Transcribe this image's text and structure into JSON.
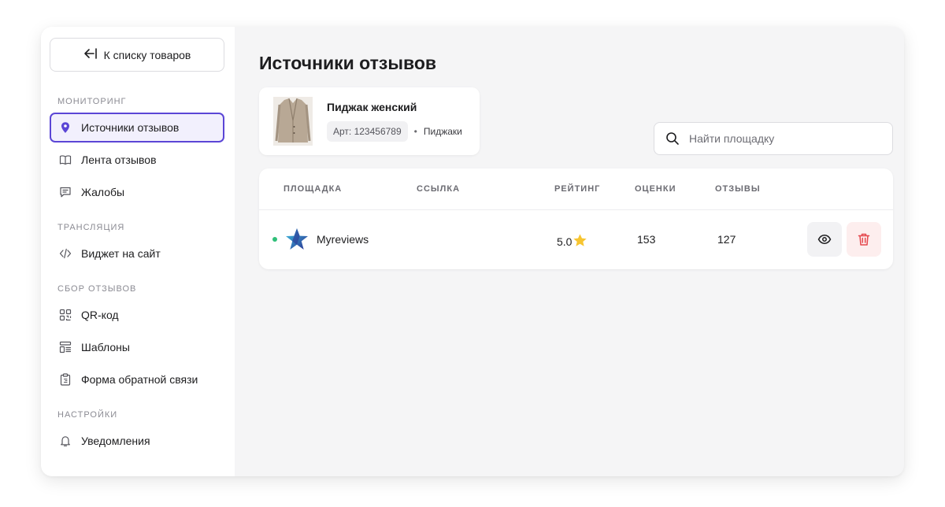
{
  "sidebar": {
    "back_label": "К списку товаров",
    "sections": [
      {
        "title": "МОНИТОРИНГ",
        "items": [
          {
            "label": "Источники отзывов",
            "icon": "location-pin-icon",
            "active": true
          },
          {
            "label": "Лента отзывов",
            "icon": "book-icon"
          },
          {
            "label": "Жалобы",
            "icon": "message-icon"
          }
        ]
      },
      {
        "title": "ТРАНСЛЯЦИЯ",
        "items": [
          {
            "label": "Виджет на сайт",
            "icon": "code-icon"
          }
        ]
      },
      {
        "title": "СБОР ОТЗЫВОВ",
        "items": [
          {
            "label": "QR-код",
            "icon": "qr-code-icon"
          },
          {
            "label": "Шаблоны",
            "icon": "template-icon"
          },
          {
            "label": "Форма обратной связи",
            "icon": "clipboard-icon"
          }
        ]
      },
      {
        "title": "НАСТРОЙКИ",
        "items": [
          {
            "label": "Уведомления",
            "icon": "bell-icon"
          }
        ]
      }
    ]
  },
  "main": {
    "title": "Источники отзывов",
    "product": {
      "name": "Пиджак женский",
      "article": "Арт: 123456789",
      "category": "Пиджаки",
      "separator": "•"
    },
    "search": {
      "placeholder": "Найти площадку",
      "value": ""
    },
    "table": {
      "headers": {
        "platform": "ПЛОЩАДКА",
        "link": "ССЫЛКА",
        "rating": "РЕЙТИНГ",
        "scores": "ОЦЕНКИ",
        "reviews": "ОТЗЫВЫ"
      },
      "rows": [
        {
          "platform": "Myreviews",
          "link": "",
          "rating": "5.0",
          "scores": "153",
          "reviews": "127",
          "status": "active"
        }
      ]
    }
  },
  "colors": {
    "accent": "#5b46d6",
    "status_active": "#2fbf79",
    "star": "#f7c531",
    "delete": "#e5484d"
  }
}
